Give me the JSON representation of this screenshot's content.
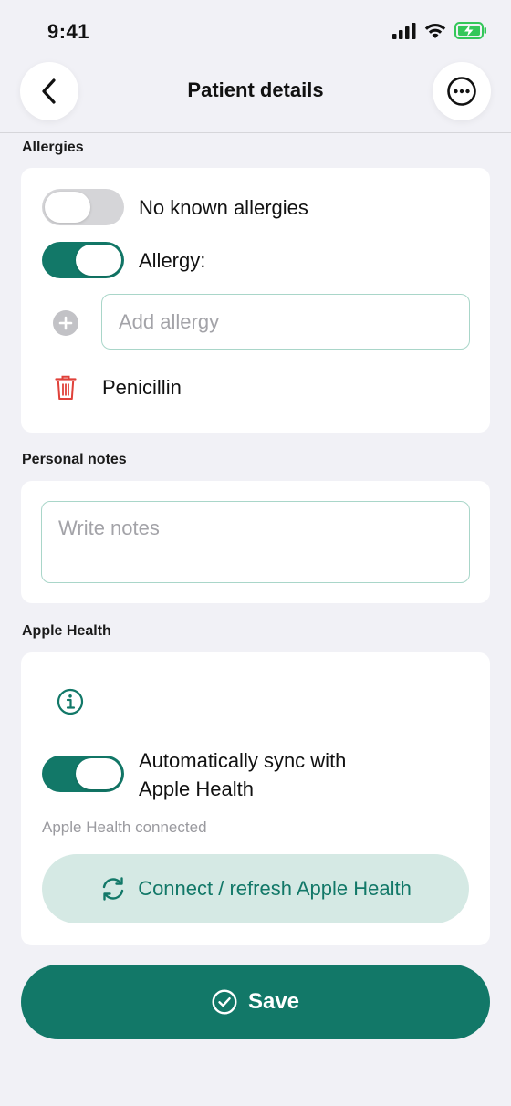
{
  "status_bar": {
    "time": "9:41"
  },
  "header": {
    "title": "Patient details",
    "back_icon": "chevron-left-icon",
    "more_icon": "ellipsis-icon"
  },
  "allergies": {
    "section_label": "Allergies",
    "no_known_label": "No known allergies",
    "no_known_on": false,
    "allergy_label": "Allergy:",
    "allergy_on": true,
    "add_placeholder": "Add allergy",
    "items": [
      {
        "name": "Penicillin"
      }
    ]
  },
  "notes": {
    "section_label": "Personal notes",
    "placeholder": "Write notes"
  },
  "apple_health": {
    "section_label": "Apple Health",
    "sync_label_line1": "Automatically sync with",
    "sync_label_line2": "Apple Health",
    "sync_on": true,
    "status_text": "Apple Health connected",
    "refresh_label": "Connect / refresh Apple Health"
  },
  "save": {
    "label": "Save"
  },
  "colors": {
    "accent": "#127868",
    "accent_light": "#d5e9e4",
    "delete": "#e0413a",
    "background": "#f1f1f6"
  }
}
